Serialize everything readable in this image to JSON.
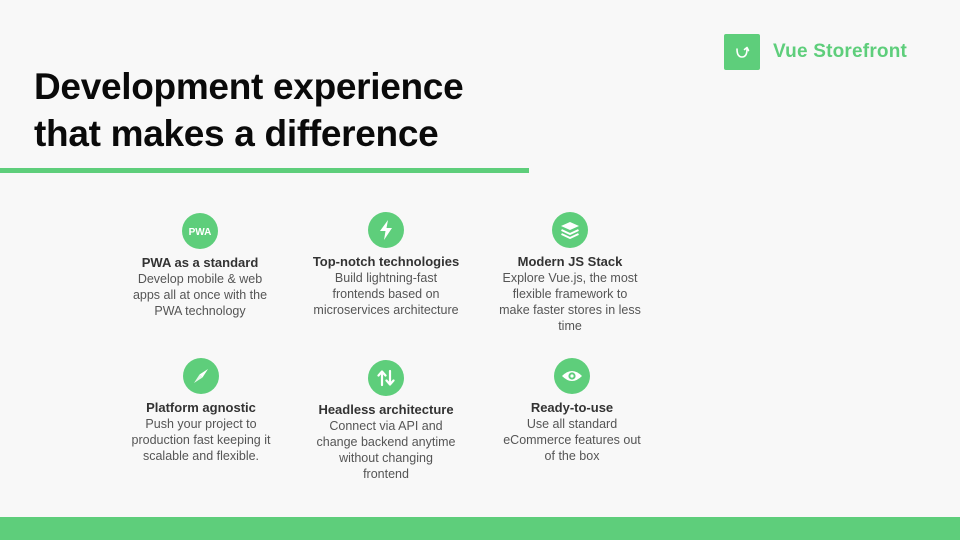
{
  "brand": {
    "name": "Vue Storefront",
    "accent_color": "#5ece7b",
    "logo_icon": "shopping-bag-icon"
  },
  "header": {
    "title_line1": "Development experience",
    "title_line2": "that makes a difference"
  },
  "features": [
    {
      "icon": "pwa-icon",
      "icon_text": "PWA",
      "title": "PWA as a standard",
      "desc_lines": [
        "Develop mobile & web",
        "apps all at once with the",
        "PWA technology"
      ]
    },
    {
      "icon": "lightning-bolt-icon",
      "title": "Top-notch technologies",
      "desc_lines": [
        "Build lightning-fast",
        "frontends based on",
        "microservices architecture"
      ]
    },
    {
      "icon": "stack-layers-icon",
      "title": "Modern JS Stack",
      "desc_lines": [
        "Explore Vue.js, the most",
        "flexible framework to",
        "make faster stores in less",
        "time"
      ]
    },
    {
      "icon": "compass-icon",
      "title": "Platform agnostic",
      "desc_lines": [
        "Push your project to",
        "production fast keeping it",
        "scalable and flexible."
      ]
    },
    {
      "icon": "swap-arrows-icon",
      "title": "Headless architecture",
      "desc_lines": [
        "Connect via API and",
        "change backend anytime",
        "without changing",
        "frontend"
      ]
    },
    {
      "icon": "eye-icon",
      "title": "Ready-to-use",
      "desc_lines": [
        "Use all standard",
        "eCommerce features out",
        "of the box"
      ]
    }
  ]
}
